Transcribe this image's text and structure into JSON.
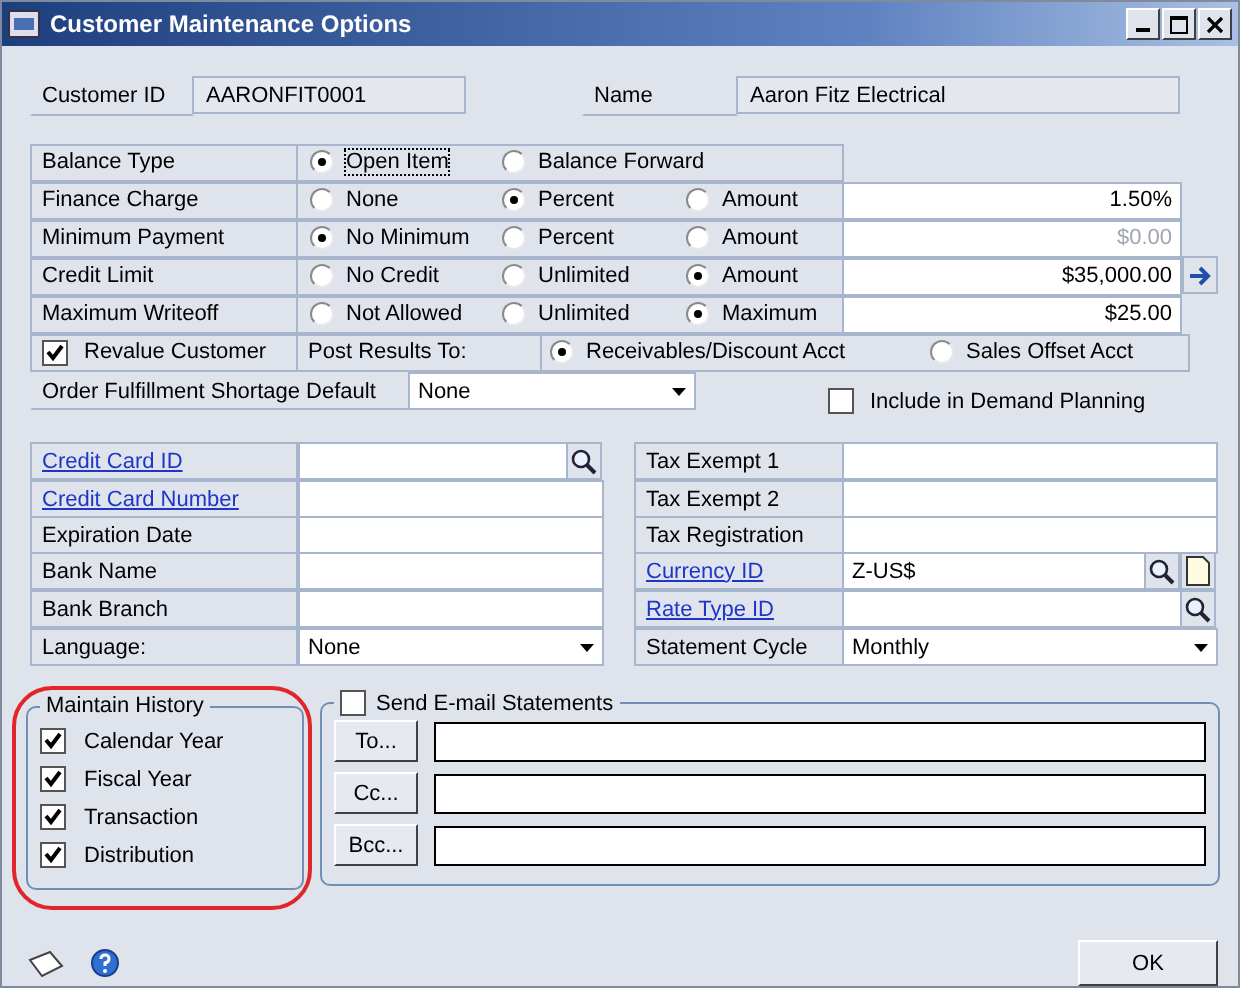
{
  "window": {
    "title": "Customer Maintenance Options"
  },
  "customer": {
    "id_label": "Customer ID",
    "id": "AARONFIT0001",
    "name_label": "Name",
    "name": "Aaron Fitz Electrical"
  },
  "options": [
    {
      "label": "Balance Type",
      "choices": [
        {
          "label": "Open Item",
          "selected": true
        },
        {
          "label": "Balance Forward",
          "selected": false
        }
      ]
    },
    {
      "label": "Finance Charge",
      "choices": [
        {
          "label": "None",
          "selected": false
        },
        {
          "label": "Percent",
          "selected": true
        },
        {
          "label": "Amount",
          "selected": false
        }
      ],
      "value": "1.50%",
      "disabled": false
    },
    {
      "label": "Minimum Payment",
      "choices": [
        {
          "label": "No Minimum",
          "selected": true
        },
        {
          "label": "Percent",
          "selected": false
        },
        {
          "label": "Amount",
          "selected": false
        }
      ],
      "value": "$0.00",
      "disabled": true
    },
    {
      "label": "Credit Limit",
      "choices": [
        {
          "label": "No Credit",
          "selected": false
        },
        {
          "label": "Unlimited",
          "selected": false
        },
        {
          "label": "Amount",
          "selected": true
        }
      ],
      "value": "$35,000.00",
      "disabled": false,
      "detail_button": true
    },
    {
      "label": "Maximum Writeoff",
      "choices": [
        {
          "label": "Not Allowed",
          "selected": false
        },
        {
          "label": "Unlimited",
          "selected": false
        },
        {
          "label": "Maximum",
          "selected": true
        }
      ],
      "value": "$25.00",
      "disabled": false
    }
  ],
  "revalue": {
    "label": "Revalue Customer",
    "checked": true,
    "post_label": "Post Results To:",
    "targets": [
      {
        "label": "Receivables/Discount Acct",
        "selected": true
      },
      {
        "label": "Sales Offset Acct",
        "selected": false
      }
    ]
  },
  "fulfillment": {
    "label": "Order Fulfillment Shortage Default",
    "value": "None"
  },
  "demand_planning": {
    "label": "Include in Demand Planning",
    "checked": false
  },
  "left_fields": [
    {
      "label": "Credit Card ID",
      "link": true,
      "kind": "text",
      "lookup": true
    },
    {
      "label": "Credit Card Number",
      "link": true,
      "kind": "text"
    },
    {
      "label": "Expiration Date",
      "link": false,
      "kind": "text"
    },
    {
      "label": "Bank Name",
      "link": false,
      "kind": "text"
    },
    {
      "label": "Bank Branch",
      "link": false,
      "kind": "text"
    },
    {
      "label": "Language:",
      "link": false,
      "kind": "dropdown",
      "value": "None"
    }
  ],
  "right_fields": [
    {
      "label": "Tax Exempt 1",
      "link": false,
      "kind": "text"
    },
    {
      "label": "Tax Exempt 2",
      "link": false,
      "kind": "text"
    },
    {
      "label": "Tax Registration",
      "link": false,
      "kind": "text"
    },
    {
      "label": "Currency ID",
      "link": true,
      "kind": "text",
      "value": "Z-US$",
      "lookup": true,
      "note": true
    },
    {
      "label": "Rate Type ID",
      "link": true,
      "kind": "text",
      "lookup": true
    },
    {
      "label": "Statement Cycle",
      "link": false,
      "kind": "dropdown",
      "value": "Monthly"
    }
  ],
  "history": {
    "title": "Maintain History",
    "highlighted": true,
    "items": [
      {
        "label": "Calendar Year",
        "checked": true
      },
      {
        "label": "Fiscal Year",
        "checked": true
      },
      {
        "label": "Transaction",
        "checked": true
      },
      {
        "label": "Distribution",
        "checked": true
      }
    ]
  },
  "email": {
    "label": "Send E-mail Statements",
    "checked": false,
    "recipients": [
      {
        "button": "To..."
      },
      {
        "button": "Cc..."
      },
      {
        "button": "Bcc..."
      }
    ]
  },
  "footer": {
    "ok": "OK"
  }
}
